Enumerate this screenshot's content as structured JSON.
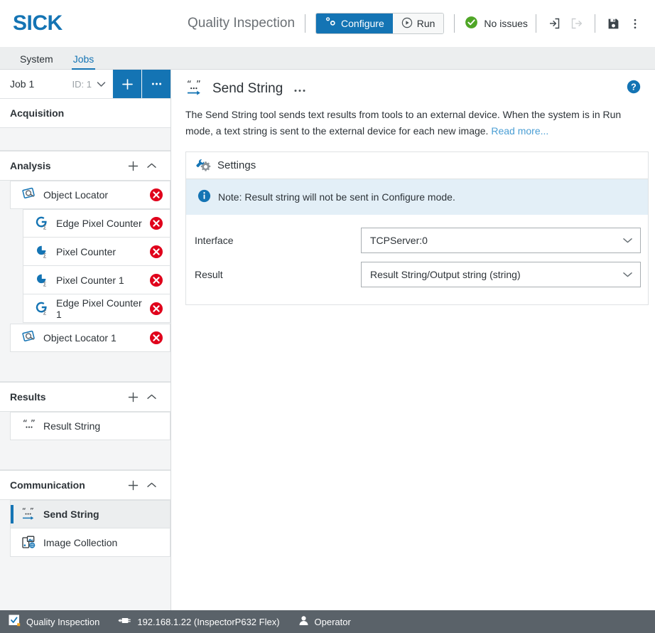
{
  "header": {
    "logo": "SICK",
    "app_title": "Quality Inspection",
    "mode": {
      "configure_label": "Configure",
      "run_label": "Run",
      "active": "Configure"
    },
    "status_label": "No issues",
    "icons": {
      "login": "login-icon",
      "logout": "logout-icon",
      "save": "save-icon",
      "overflow": "kebab-menu-icon"
    }
  },
  "tabs": [
    {
      "label": "System",
      "active": false
    },
    {
      "label": "Jobs",
      "active": true
    }
  ],
  "sidebar": {
    "job": {
      "name": "Job 1",
      "id_label": "ID: 1",
      "add_label": "+",
      "more_label": "•••"
    },
    "sections": [
      {
        "title": "Acquisition",
        "has_add": false,
        "has_collapse": false,
        "items": []
      },
      {
        "title": "Analysis",
        "has_add": true,
        "has_collapse": true,
        "items": [
          {
            "label": "Object Locator",
            "icon": "object-locator-icon",
            "indent": 0,
            "deletable": true,
            "selected": false
          },
          {
            "label": "Edge Pixel Counter",
            "icon": "edge-pixel-counter-icon",
            "indent": 1,
            "deletable": true,
            "selected": false
          },
          {
            "label": "Pixel Counter",
            "icon": "pixel-counter-icon",
            "indent": 1,
            "deletable": true,
            "selected": false
          },
          {
            "label": "Pixel Counter 1",
            "icon": "pixel-counter-icon",
            "indent": 1,
            "deletable": true,
            "selected": false
          },
          {
            "label": "Edge Pixel Counter 1",
            "icon": "edge-pixel-counter-icon",
            "indent": 1,
            "deletable": true,
            "selected": false
          },
          {
            "label": "Object Locator 1",
            "icon": "object-locator-icon",
            "indent": 0,
            "deletable": true,
            "selected": false
          }
        ]
      },
      {
        "title": "Results",
        "has_add": true,
        "has_collapse": true,
        "items": [
          {
            "label": "Result String",
            "icon": "result-string-icon",
            "indent": 0,
            "deletable": false,
            "selected": false
          }
        ]
      },
      {
        "title": "Communication",
        "has_add": true,
        "has_collapse": true,
        "items": [
          {
            "label": "Send String",
            "icon": "send-string-icon",
            "indent": 0,
            "deletable": false,
            "selected": true
          },
          {
            "label": "Image Collection",
            "icon": "image-collection-icon",
            "indent": 0,
            "deletable": false,
            "selected": false
          }
        ]
      }
    ]
  },
  "main": {
    "title": "Send String",
    "title_icon": "send-string-icon",
    "kebab": "•••",
    "help_icon": "help-icon",
    "description_part1": "The Send String tool sends text results from tools to an external device. When the system is in Run mode, a text string is sent to the external device for each new image. ",
    "read_more_label": "Read more...",
    "card": {
      "title": "Settings",
      "icon": "settings-wrench-gear-icon",
      "note": "Note: Result string will not be sent in Configure mode.",
      "fields": [
        {
          "label": "Interface",
          "value": "TCPServer:0"
        },
        {
          "label": "Result",
          "value": "Result String/Output string (string)"
        }
      ]
    }
  },
  "statusbar": {
    "app_name": "Quality Inspection",
    "device": "192.168.1.22 (InspectorP632 Flex)",
    "user": "Operator"
  },
  "colors": {
    "brand_blue": "#1474b4",
    "status_green": "#4fa626",
    "delete_red": "#e0001b",
    "statusbar_gray": "#5a6269",
    "note_bg": "#e3eff7"
  }
}
